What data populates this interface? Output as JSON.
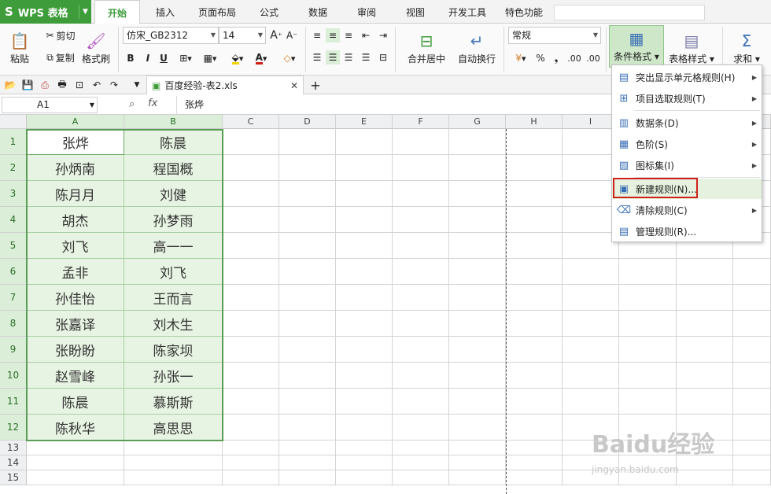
{
  "app": {
    "title": "WPS 表格"
  },
  "menu_tabs": [
    {
      "label": "开始",
      "active": true
    },
    {
      "label": "插入"
    },
    {
      "label": "页面布局"
    },
    {
      "label": "公式"
    },
    {
      "label": "数据"
    },
    {
      "label": "审阅"
    },
    {
      "label": "视图"
    },
    {
      "label": "开发工具"
    },
    {
      "label": "特色功能"
    }
  ],
  "ribbon": {
    "paste": "粘贴",
    "cut": "剪切",
    "copy": "复制",
    "format_painter": "格式刷",
    "font_name": "仿宋_GB2312",
    "font_size": "14",
    "merge_center": "合并居中",
    "wrap_text": "自动换行",
    "number_format": "常规",
    "conditional_format": "条件格式",
    "table_style": "表格样式",
    "sum": "求和",
    "bold": "B",
    "italic": "I",
    "underline": "U",
    "percent": "%",
    "comma": "❟",
    "inc_decimal": ".00",
    "dec_decimal": ".00"
  },
  "file_tab": {
    "name": "百度经验-表2.xls"
  },
  "formula_bar": {
    "cell_ref": "A1",
    "fx": "fx",
    "value": "张烨"
  },
  "columns": [
    "A",
    "B",
    "C",
    "D",
    "E",
    "F",
    "G",
    "H",
    "I"
  ],
  "rows": [
    "1",
    "2",
    "3",
    "4",
    "5",
    "6",
    "7",
    "8",
    "9",
    "10",
    "11",
    "12",
    "13",
    "14",
    "15"
  ],
  "table": [
    [
      "张烨",
      "陈晨"
    ],
    [
      "孙炳南",
      "程国概"
    ],
    [
      "陈月月",
      "刘健"
    ],
    [
      "胡杰",
      "孙梦雨"
    ],
    [
      "刘飞",
      "高一一"
    ],
    [
      "孟非",
      "刘飞"
    ],
    [
      "孙佳怡",
      "王而言"
    ],
    [
      "张嘉译",
      "刘木生"
    ],
    [
      "张盼盼",
      "陈家坝"
    ],
    [
      "赵雪峰",
      "孙张一"
    ],
    [
      "陈晨",
      "慕斯斯"
    ],
    [
      "陈秋华",
      "高思思"
    ]
  ],
  "dropdown": {
    "items": [
      {
        "label": "突出显示单元格规则(H)",
        "icon": "highlight-rules-icon",
        "submenu": true
      },
      {
        "label": "项目选取规则(T)",
        "icon": "top-bottom-rules-icon",
        "submenu": true
      },
      {
        "label": "数据条(D)",
        "icon": "data-bars-icon",
        "submenu": true
      },
      {
        "label": "色阶(S)",
        "icon": "color-scale-icon",
        "submenu": true
      },
      {
        "label": "图标集(I)",
        "icon": "icon-sets-icon",
        "submenu": true
      },
      {
        "label": "新建规则(N)...",
        "icon": "new-rule-icon",
        "submenu": false,
        "highlighted": true
      },
      {
        "label": "清除规则(C)",
        "icon": "clear-rules-icon",
        "submenu": true
      },
      {
        "label": "管理规则(R)...",
        "icon": "manage-rules-icon",
        "submenu": false
      }
    ]
  },
  "watermark": {
    "text": "Baidu经验",
    "url": "jingyan.baidu.com"
  }
}
